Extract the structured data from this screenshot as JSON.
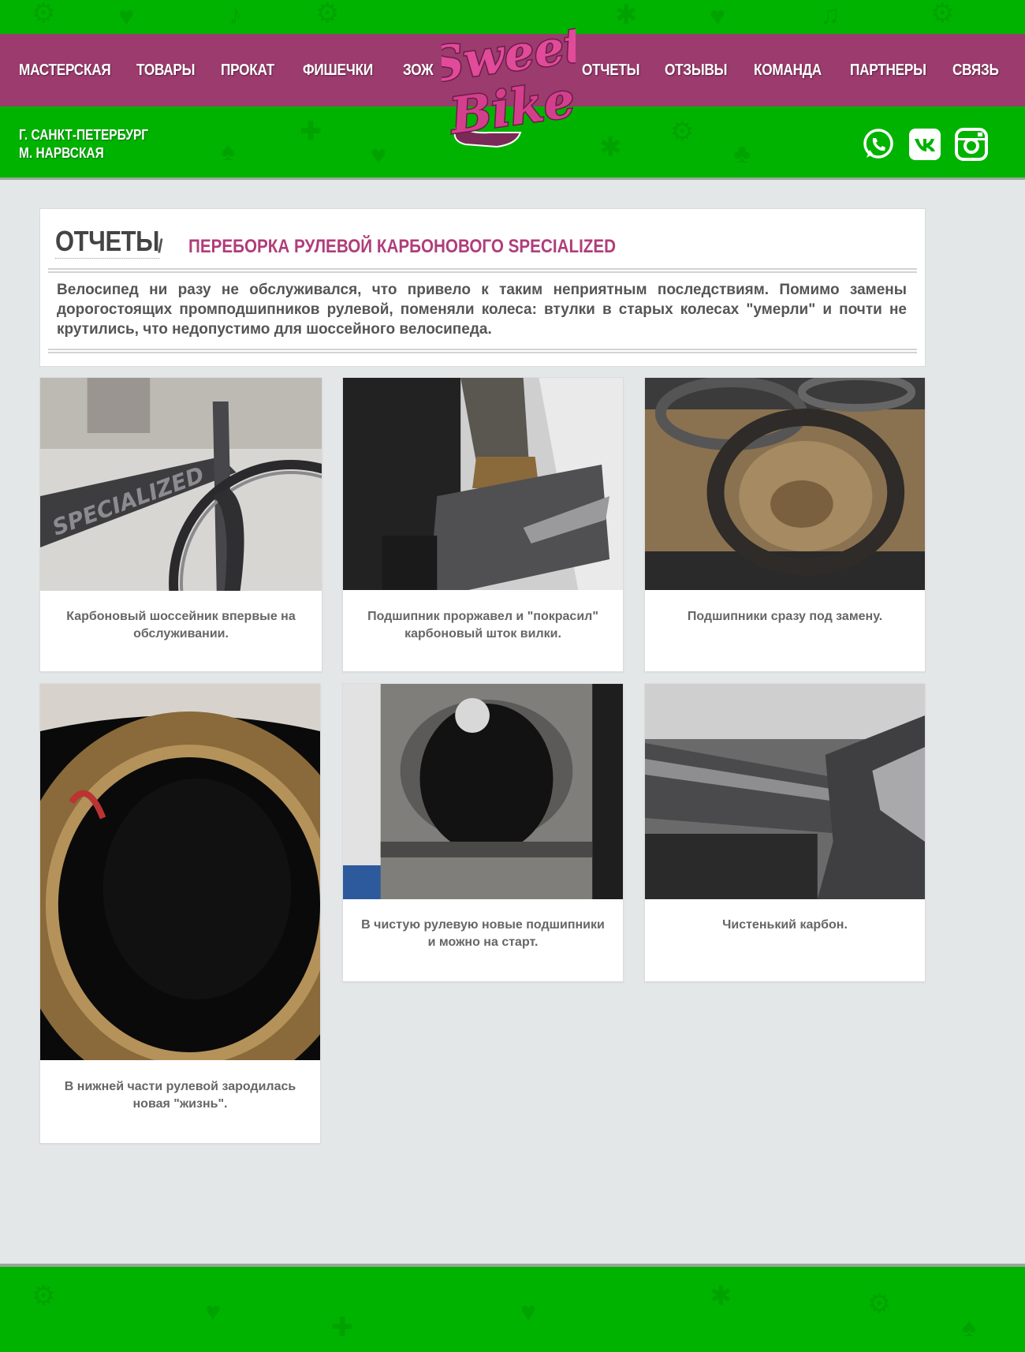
{
  "nav": {
    "left": [
      {
        "label": "МАСТЕРСКАЯ"
      },
      {
        "label": "ТОВАРЫ"
      },
      {
        "label": "ПРОКАТ"
      },
      {
        "label": "ФИШЕЧКИ"
      },
      {
        "label": "ЗОЖ"
      }
    ],
    "right": [
      {
        "label": "ОТЧЕТЫ"
      },
      {
        "label": "ОТЗЫВЫ"
      },
      {
        "label": "КОМАНДА"
      },
      {
        "label": "ПАРТНЕРЫ"
      },
      {
        "label": "СВЯЗЬ"
      }
    ]
  },
  "logo": {
    "line1": "Sweet",
    "line2": "Bike"
  },
  "location": {
    "city": "Г. САНКТ-ПЕТЕРБУРГ",
    "metro": "М. НАРВСКАЯ"
  },
  "social": [
    {
      "icon": "whatsapp-icon"
    },
    {
      "icon": "vk-icon"
    },
    {
      "icon": "instagram-icon"
    }
  ],
  "page": {
    "section": "ОТЧЕТЫ",
    "separator": "/",
    "title": "ПЕРЕБОРКА РУЛЕВОЙ КАРБОНОВОГО SPECIALIZED",
    "description": "Велосипед ни разу не обслуживался, что привело к таким неприятным последствиям. Помимо замены дорогостоящих промподшипников рулевой, поменяли колеса: втулки в старых колесах \"умерли\" и почти не крутились, что недопустимо для шоссейного велосипеда."
  },
  "gallery": [
    {
      "caption": "Карбоновый шоссейник впервые на обслуживании.",
      "photo_text": "SPECIALIZED"
    },
    {
      "caption": "Подшипник проржавел и \"покрасил\" карбоновый шток вилки."
    },
    {
      "caption": "Подшипники сразу под замену."
    },
    {
      "caption": "В нижней части рулевой зародилась новая \"жизнь\"."
    },
    {
      "caption": "В чистую рулевую новые подшипники и можно на старт."
    },
    {
      "caption": "Чистенький карбон."
    }
  ],
  "colors": {
    "green": "#00b300",
    "navbar": "#9c3b6e",
    "accent": "#b03d7a",
    "background": "#e4e7e8"
  }
}
